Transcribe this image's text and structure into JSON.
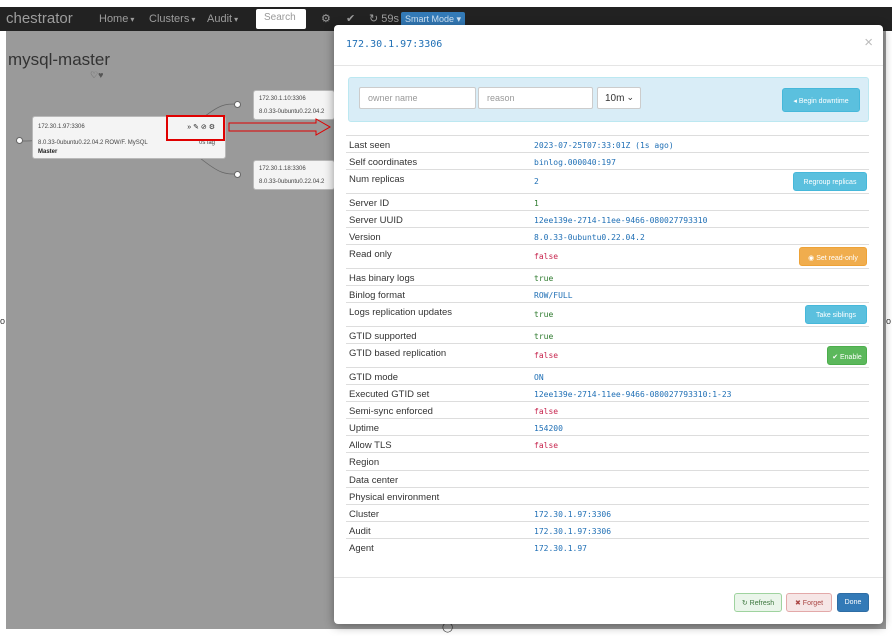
{
  "app": {
    "brand": "chestrator",
    "nav": [
      {
        "label": "Home"
      },
      {
        "label": "Clusters"
      },
      {
        "label": "Audit"
      }
    ],
    "search_placeholder": "Search",
    "refresh_timer": "59s",
    "smart_mode_label": "Smart Mode"
  },
  "topology": {
    "cluster_title": "mysql-master",
    "hearts": "♡♥",
    "master": {
      "host": "172.30.1.97:3306",
      "version": "8.0.33-0ubuntu0.22.04.2 ROW/F. MySQL",
      "lag": "0s lag",
      "role": "Master",
      "tools": "» ✎ ⊘ ⚙"
    },
    "replicas": [
      {
        "host": "172.30.1.10:3306",
        "version": "8.0.33-0ubuntu0.22.04.2"
      },
      {
        "host": "172.30.1.18:3306",
        "version": "8.0.33-0ubuntu0.22.04.2"
      }
    ]
  },
  "modal": {
    "title": "172.30.1.97:3306",
    "close": "×",
    "downtime": {
      "owner_placeholder": "owner name",
      "reason_placeholder": "reason",
      "duration": "10m",
      "begin_label": "Begin downtime"
    },
    "properties": [
      {
        "name": "Last seen",
        "value": "2023-07-25T07:33:01Z (1s ago)",
        "kind": "text"
      },
      {
        "name": "Self coordinates",
        "value": "binlog.000040:197",
        "kind": "text"
      },
      {
        "name": "Num replicas",
        "value": "2",
        "kind": "text",
        "button": "Regroup replicas",
        "button_style": "info"
      },
      {
        "name": "Server ID",
        "value": "1",
        "kind": "true"
      },
      {
        "name": "Server UUID",
        "value": "12ee139e-2714-11ee-9466-080027793310",
        "kind": "text"
      },
      {
        "name": "Version",
        "value": "8.0.33-0ubuntu0.22.04.2",
        "kind": "text"
      },
      {
        "name": "Read only",
        "value": "false",
        "kind": "false",
        "button": "Set read-only",
        "button_style": "warning",
        "button_icon": "eye-icon"
      },
      {
        "name": "Has binary logs",
        "value": "true",
        "kind": "true"
      },
      {
        "name": "Binlog format",
        "value": "ROW/FULL",
        "kind": "text"
      },
      {
        "name": "Logs replication updates",
        "value": "true",
        "kind": "true",
        "button": "Take siblings",
        "button_style": "info"
      },
      {
        "name": "GTID supported",
        "value": "true",
        "kind": "true"
      },
      {
        "name": "GTID based replication",
        "value": "false",
        "kind": "false",
        "button": "Enable",
        "button_style": "success",
        "button_icon": "check-circle-icon"
      },
      {
        "name": "GTID mode",
        "value": "ON",
        "kind": "text"
      },
      {
        "name": "Executed GTID set",
        "value": "12ee139e-2714-11ee-9466-080027793310:1-23",
        "kind": "text"
      },
      {
        "name": "Semi-sync enforced",
        "value": "false",
        "kind": "false"
      },
      {
        "name": "Uptime",
        "value": "154200",
        "kind": "text"
      },
      {
        "name": "Allow TLS",
        "value": "false",
        "kind": "false"
      },
      {
        "name": "Region",
        "value": "",
        "kind": "text"
      },
      {
        "name": "Data center",
        "value": "",
        "kind": "text"
      },
      {
        "name": "Physical environment",
        "value": "",
        "kind": "text"
      },
      {
        "name": "Cluster",
        "value": "172.30.1.97:3306",
        "kind": "text"
      },
      {
        "name": "Audit",
        "value": "172.30.1.97:3306",
        "kind": "text"
      },
      {
        "name": "Agent",
        "value": "172.30.1.97",
        "kind": "text"
      }
    ],
    "footer": {
      "refresh_label": "Refresh",
      "forget_label": "Forget",
      "done_label": "Done"
    }
  },
  "colors": {
    "navbar": "#222222",
    "accent": "#337ab7",
    "info": "#5bc0de",
    "warning": "#f0ad4e",
    "success": "#5cb85c",
    "value_blue": "#1f6fb5",
    "value_false": "#c7254e",
    "highlight": "#e00000"
  }
}
